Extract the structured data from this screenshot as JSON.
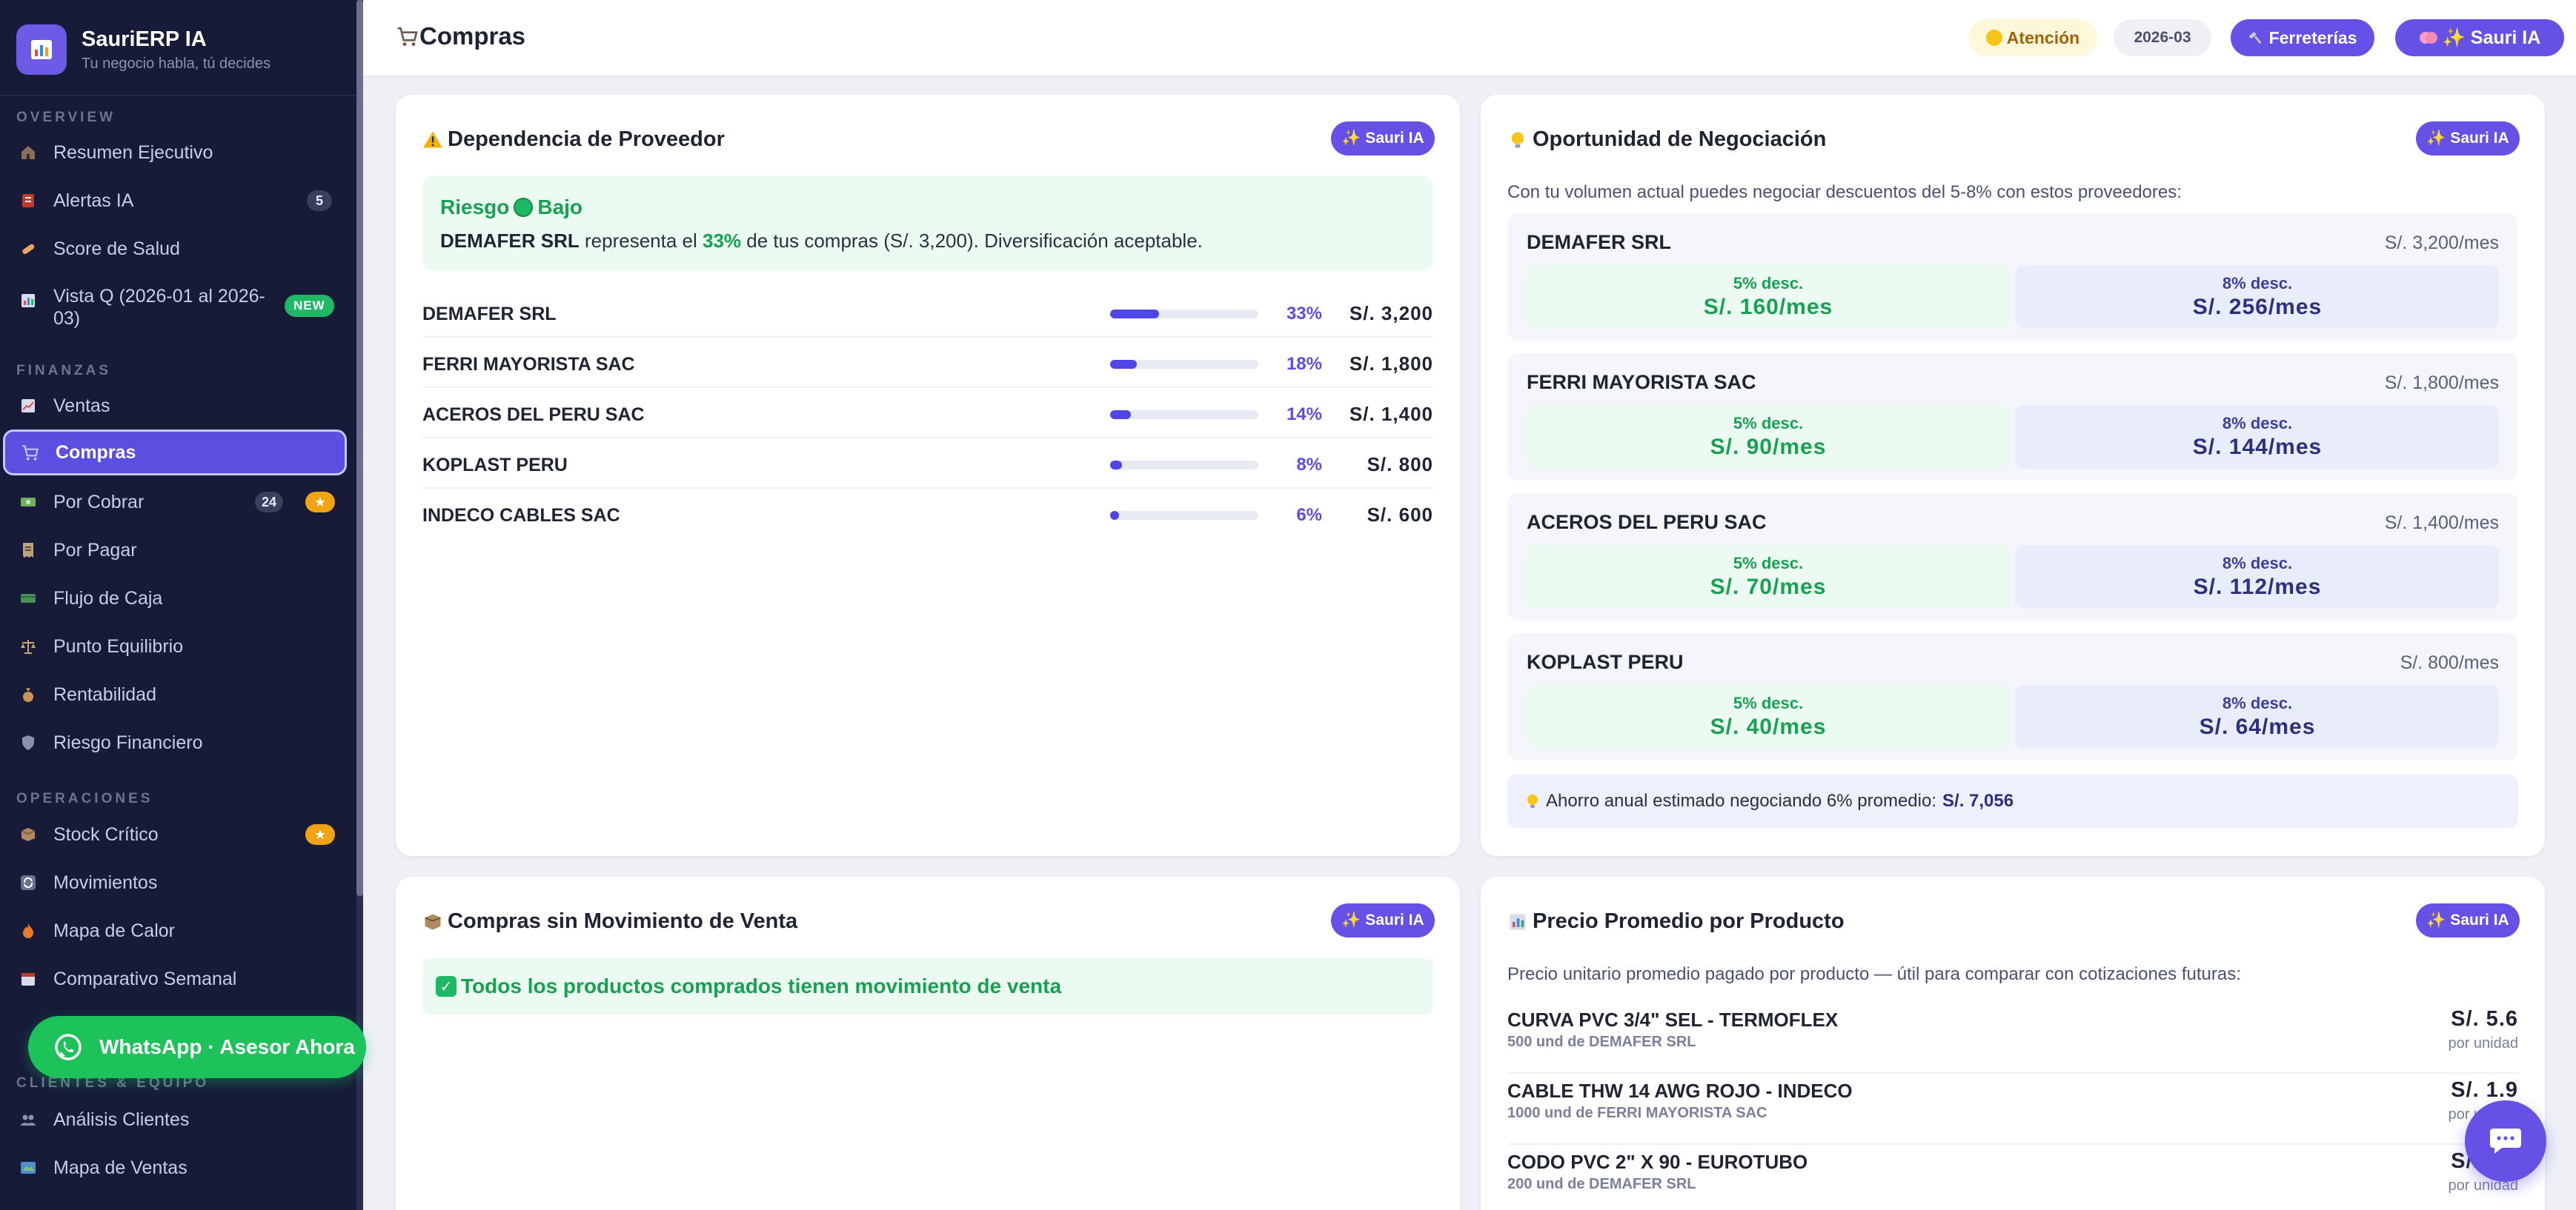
{
  "brand": {
    "name": "SauriERP IA",
    "tagline": "Tu negocio habla, tú decides"
  },
  "sidebar": {
    "sections": {
      "overview": "OVERVIEW",
      "finanzas": "FINANZAS",
      "operaciones": "OPERACIONES",
      "clientes": "CLIENTES & EQUIPO"
    },
    "items": [
      {
        "label": "Resumen Ejecutivo",
        "icon": "home-icon"
      },
      {
        "label": "Alertas IA",
        "icon": "alert-icon",
        "badge": "5"
      },
      {
        "label": "Score de Salud",
        "icon": "pill-icon"
      },
      {
        "label": "Vista Q (2026-01 al 2026-03)",
        "icon": "chart-icon",
        "badge": "NEW"
      },
      {
        "label": "Ventas",
        "icon": "trend-icon"
      },
      {
        "label": "Compras",
        "icon": "cart-icon",
        "active": true
      },
      {
        "label": "Por Cobrar",
        "icon": "money-icon",
        "badge": "24",
        "star": "★"
      },
      {
        "label": "Por Pagar",
        "icon": "receipt-icon"
      },
      {
        "label": "Flujo de Caja",
        "icon": "cash-icon"
      },
      {
        "label": "Punto Equilibrio",
        "icon": "balance-icon"
      },
      {
        "label": "Rentabilidad",
        "icon": "moneybag-icon"
      },
      {
        "label": "Riesgo Financiero",
        "icon": "shield-icon"
      },
      {
        "label": "Stock Crítico",
        "icon": "box-icon",
        "star": "★"
      },
      {
        "label": "Movimientos",
        "icon": "refresh-icon"
      },
      {
        "label": "Mapa de Calor",
        "icon": "fire-icon"
      },
      {
        "label": "Comparativo Semanal",
        "icon": "calendar-icon"
      },
      {
        "label": "Análisis Clientes",
        "icon": "users-icon"
      },
      {
        "label": "Mapa de Ventas",
        "icon": "map-icon"
      }
    ],
    "whatsapp": "WhatsApp · Asesor Ahora"
  },
  "header": {
    "title": "Compras",
    "alert": "Atención",
    "period": "2026-03",
    "ferreterias": "Ferreterías",
    "sauri": "✨ Sauri IA"
  },
  "ia_button": "✨ Sauri IA",
  "dependencia": {
    "title": "Dependencia de Proveedor",
    "risk_label": "Riesgo",
    "risk_level": "Bajo",
    "risk_supplier": "DEMAFER SRL",
    "risk_text_a": " representa el ",
    "risk_pct": "33%",
    "risk_text_b": " de tus compras (S/. 3,200). Diversificación aceptable.",
    "rows": [
      {
        "name": "DEMAFER SRL",
        "pct": "33%",
        "share": 0.33,
        "amount": "S/. 3,200"
      },
      {
        "name": "FERRI MAYORISTA SAC",
        "pct": "18%",
        "share": 0.18,
        "amount": "S/. 1,800"
      },
      {
        "name": "ACEROS DEL PERU SAC",
        "pct": "14%",
        "share": 0.14,
        "amount": "S/. 1,400"
      },
      {
        "name": "KOPLAST PERU",
        "pct": "8%",
        "share": 0.08,
        "amount": "S/. 800"
      },
      {
        "name": "INDECO CABLES SAC",
        "pct": "6%",
        "share": 0.06,
        "amount": "S/. 600"
      }
    ]
  },
  "oportunidad": {
    "title": "Oportunidad de Negociación",
    "subtitle": "Con tu volumen actual puedes negociar descuentos del 5-8% con estos proveedores:",
    "blocks": [
      {
        "name": "DEMAFER SRL",
        "monthly": "S/. 3,200/mes",
        "d5_label": "5% desc.",
        "d5": "S/. 160/mes",
        "d8_label": "8% desc.",
        "d8": "S/. 256/mes"
      },
      {
        "name": "FERRI MAYORISTA SAC",
        "monthly": "S/. 1,800/mes",
        "d5_label": "5% desc.",
        "d5": "S/. 90/mes",
        "d8_label": "8% desc.",
        "d8": "S/. 144/mes"
      },
      {
        "name": "ACEROS DEL PERU SAC",
        "monthly": "S/. 1,400/mes",
        "d5_label": "5% desc.",
        "d5": "S/. 70/mes",
        "d8_label": "8% desc.",
        "d8": "S/. 112/mes"
      },
      {
        "name": "KOPLAST PERU",
        "monthly": "S/. 800/mes",
        "d5_label": "5% desc.",
        "d5": "S/. 40/mes",
        "d8_label": "8% desc.",
        "d8": "S/. 64/mes"
      }
    ],
    "savings_label": "Ahorro anual estimado negociando 6% promedio:",
    "savings_value": "S/. 7,056"
  },
  "sin_movimiento": {
    "title": "Compras sin Movimiento de Venta",
    "message": "Todos los productos comprados tienen movimiento de venta"
  },
  "precio_promedio": {
    "title": "Precio Promedio por Producto",
    "subtitle": "Precio unitario promedio pagado por producto — útil para comparar con cotizaciones futuras:",
    "rows": [
      {
        "name": "CURVA PVC 3/4\" SEL - TERMOFLEX",
        "meta": "500 und de DEMAFER SRL",
        "price": "S/. 5.6",
        "unit": "por unidad"
      },
      {
        "name": "CABLE THW 14 AWG ROJO - INDECO",
        "meta": "1000 und de FERRI MAYORISTA SAC",
        "price": "S/. 1.9",
        "unit": "por unidad"
      },
      {
        "name": "CODO PVC 2\" X 90 - EUROTUBO",
        "meta": "200 und de DEMAFER SRL",
        "price": "S/. 3.5",
        "unit": "por unidad"
      }
    ]
  }
}
